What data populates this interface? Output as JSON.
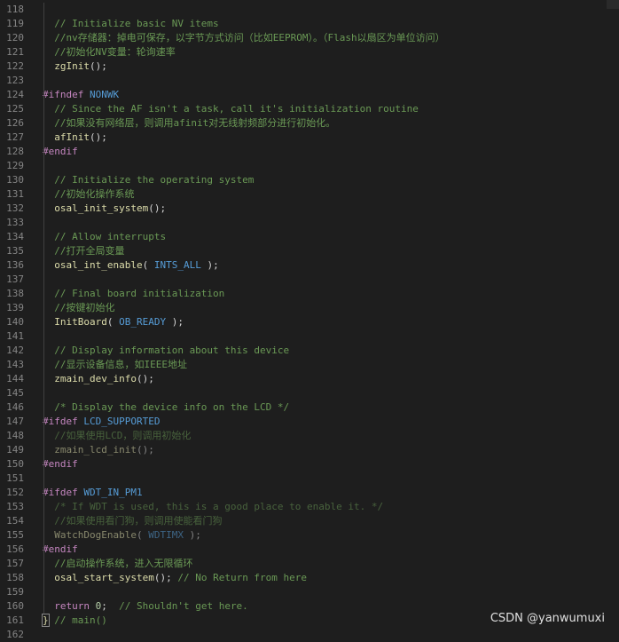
{
  "lines": [
    {
      "n": "118",
      "parts": []
    },
    {
      "n": "119",
      "parts": [
        {
          "t": "  // Initialize basic NV items",
          "c": "comment"
        }
      ]
    },
    {
      "n": "120",
      "parts": [
        {
          "t": "  //nv存储器：掉电可保存，以字节方式访问（比如EEPROM）。（Flash以扇区为单位访问）",
          "c": "comment"
        }
      ]
    },
    {
      "n": "121",
      "parts": [
        {
          "t": "  //初始化NV变量：轮询速率",
          "c": "comment"
        }
      ]
    },
    {
      "n": "122",
      "parts": [
        {
          "t": "  zgInit",
          "c": "func"
        },
        {
          "t": "();",
          "c": "plain"
        }
      ]
    },
    {
      "n": "123",
      "parts": []
    },
    {
      "n": "124",
      "parts": [
        {
          "t": "#ifndef ",
          "c": "kw"
        },
        {
          "t": "NONWK",
          "c": "macro"
        }
      ]
    },
    {
      "n": "125",
      "parts": [
        {
          "t": "  // Since the AF isn't a task, call it's initialization routine",
          "c": "comment"
        }
      ]
    },
    {
      "n": "126",
      "parts": [
        {
          "t": "  //如果没有网络层，则调用afinit对无线射频部分进行初始化。",
          "c": "comment"
        }
      ]
    },
    {
      "n": "127",
      "parts": [
        {
          "t": "  afInit",
          "c": "func"
        },
        {
          "t": "();",
          "c": "plain"
        }
      ]
    },
    {
      "n": "128",
      "parts": [
        {
          "t": "#endif",
          "c": "kw"
        }
      ]
    },
    {
      "n": "129",
      "parts": []
    },
    {
      "n": "130",
      "parts": [
        {
          "t": "  // Initialize the operating system",
          "c": "comment"
        }
      ]
    },
    {
      "n": "131",
      "parts": [
        {
          "t": "  //初始化操作系统",
          "c": "comment"
        }
      ]
    },
    {
      "n": "132",
      "parts": [
        {
          "t": "  osal_init_system",
          "c": "func"
        },
        {
          "t": "();",
          "c": "plain"
        }
      ]
    },
    {
      "n": "133",
      "parts": []
    },
    {
      "n": "134",
      "parts": [
        {
          "t": "  // Allow interrupts",
          "c": "comment"
        }
      ]
    },
    {
      "n": "135",
      "parts": [
        {
          "t": "  //打开全局变量",
          "c": "comment"
        }
      ]
    },
    {
      "n": "136",
      "parts": [
        {
          "t": "  osal_int_enable",
          "c": "func"
        },
        {
          "t": "( ",
          "c": "plain"
        },
        {
          "t": "INTS_ALL",
          "c": "macro"
        },
        {
          "t": " );",
          "c": "plain"
        }
      ]
    },
    {
      "n": "137",
      "parts": []
    },
    {
      "n": "138",
      "parts": [
        {
          "t": "  // Final board initialization",
          "c": "comment"
        }
      ]
    },
    {
      "n": "139",
      "parts": [
        {
          "t": "  //按键初始化",
          "c": "comment"
        }
      ]
    },
    {
      "n": "140",
      "parts": [
        {
          "t": "  InitBoard",
          "c": "func"
        },
        {
          "t": "( ",
          "c": "plain"
        },
        {
          "t": "OB_READY",
          "c": "macro"
        },
        {
          "t": " );",
          "c": "plain"
        }
      ]
    },
    {
      "n": "141",
      "parts": []
    },
    {
      "n": "142",
      "parts": [
        {
          "t": "  // Display information about this device",
          "c": "comment"
        }
      ]
    },
    {
      "n": "143",
      "parts": [
        {
          "t": "  //显示设备信息，如IEEE地址",
          "c": "comment"
        }
      ]
    },
    {
      "n": "144",
      "parts": [
        {
          "t": "  zmain_dev_info",
          "c": "func"
        },
        {
          "t": "();",
          "c": "plain"
        }
      ]
    },
    {
      "n": "145",
      "parts": []
    },
    {
      "n": "146",
      "parts": [
        {
          "t": "  /* Display the device info on the LCD */",
          "c": "comment"
        }
      ]
    },
    {
      "n": "147",
      "parts": [
        {
          "t": "#ifdef ",
          "c": "kw"
        },
        {
          "t": "LCD_SUPPORTED",
          "c": "macro"
        }
      ]
    },
    {
      "n": "148",
      "parts": [
        {
          "t": "  //如果使用LCD，则调用初始化",
          "c": "comment dim"
        }
      ]
    },
    {
      "n": "149",
      "parts": [
        {
          "t": "  zmain_lcd_init",
          "c": "func dim"
        },
        {
          "t": "();",
          "c": "plain dim"
        }
      ]
    },
    {
      "n": "150",
      "parts": [
        {
          "t": "#endif",
          "c": "kw"
        }
      ]
    },
    {
      "n": "151",
      "parts": []
    },
    {
      "n": "152",
      "parts": [
        {
          "t": "#ifdef ",
          "c": "kw"
        },
        {
          "t": "WDT_IN_PM1",
          "c": "macro"
        }
      ]
    },
    {
      "n": "153",
      "parts": [
        {
          "t": "  /* If WDT is used, this is a good place to enable it. */",
          "c": "comment dim"
        }
      ]
    },
    {
      "n": "154",
      "parts": [
        {
          "t": "  //如果使用看门狗，则调用使能看门狗",
          "c": "comment dim"
        }
      ]
    },
    {
      "n": "155",
      "parts": [
        {
          "t": "  WatchDogEnable",
          "c": "func dim"
        },
        {
          "t": "( ",
          "c": "plain dim"
        },
        {
          "t": "WDTIMX",
          "c": "macro dim"
        },
        {
          "t": " );",
          "c": "plain dim"
        }
      ]
    },
    {
      "n": "156",
      "parts": [
        {
          "t": "#endif",
          "c": "kw"
        }
      ]
    },
    {
      "n": "157",
      "parts": [
        {
          "t": "  //启动操作系统，进入无限循环",
          "c": "comment"
        }
      ]
    },
    {
      "n": "158",
      "parts": [
        {
          "t": "  osal_start_system",
          "c": "func"
        },
        {
          "t": "(); ",
          "c": "plain"
        },
        {
          "t": "// No Return from here",
          "c": "comment"
        }
      ]
    },
    {
      "n": "159",
      "parts": []
    },
    {
      "n": "160",
      "parts": [
        {
          "t": "  return",
          "c": "kw"
        },
        {
          "t": " ",
          "c": "plain"
        },
        {
          "t": "0",
          "c": "num"
        },
        {
          "t": ";  ",
          "c": "plain"
        },
        {
          "t": "// Shouldn't get here.",
          "c": "comment"
        }
      ]
    },
    {
      "n": "161",
      "parts": [
        {
          "t": "}",
          "c": "brace"
        },
        {
          "t": " // main()",
          "c": "comment"
        }
      ]
    },
    {
      "n": "162",
      "parts": []
    }
  ],
  "watermark": "CSDN @yanwumuxi",
  "colors": {
    "background": "#1e1e1e",
    "comment": "#6a9955",
    "function": "#dcdcaa",
    "macro": "#569cd6",
    "keyword": "#c586c0",
    "number": "#b5cea8"
  }
}
